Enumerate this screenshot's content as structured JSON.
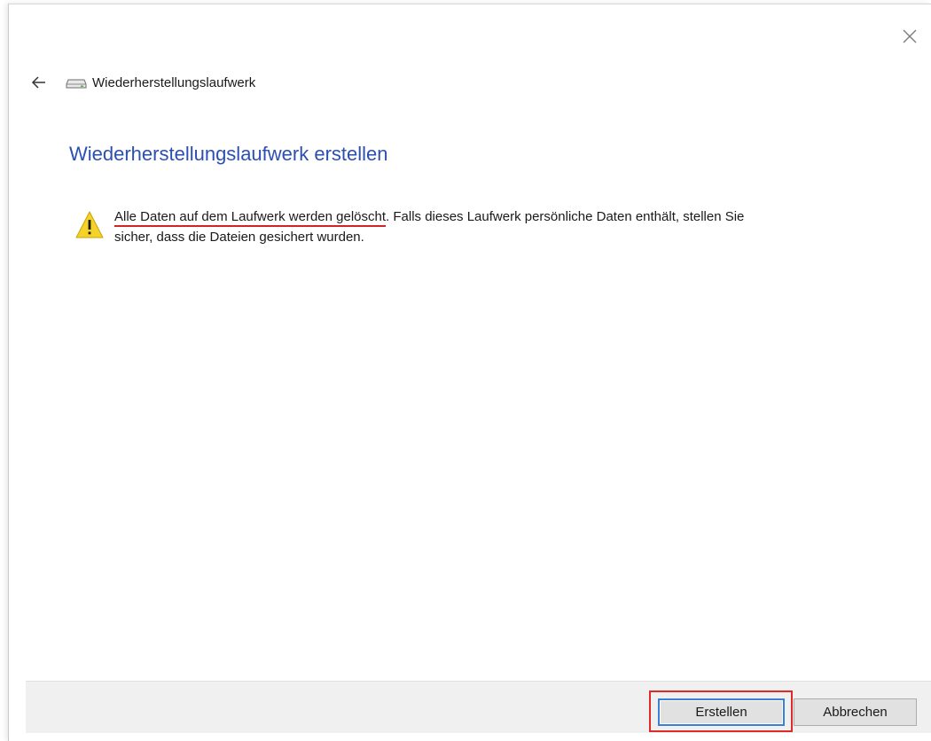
{
  "nav": {
    "back_icon": "back-arrow-icon",
    "drive_icon": "drive-icon",
    "title": "Wiederherstellungslaufwerk"
  },
  "window": {
    "close_icon": "close-icon"
  },
  "main": {
    "heading": "Wiederherstellungslaufwerk erstellen",
    "warning_icon": "warning-icon",
    "warning_strong": "Alle Daten auf dem Laufwerk werden gelöscht",
    "warning_rest": ". Falls dieses Laufwerk persönliche Daten enthält, stellen Sie sicher, dass die Dateien gesichert wurden."
  },
  "footer": {
    "create_label": "Erstellen",
    "cancel_label": "Abbrechen"
  },
  "colors": {
    "heading": "#2b4fb3",
    "annotation_red": "#e02a2a",
    "focus_blue": "#3c7fd6",
    "warning_yellow": "#f5d22a"
  }
}
